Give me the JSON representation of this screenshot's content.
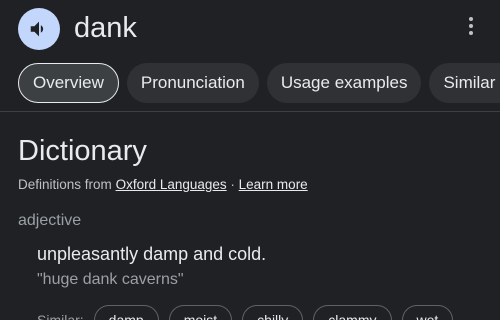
{
  "header": {
    "word": "dank",
    "speaker_icon": "volume-icon",
    "more_icon": "more-vert-icon"
  },
  "tabs": [
    {
      "label": "Overview",
      "active": true
    },
    {
      "label": "Pronunciation",
      "active": false
    },
    {
      "label": "Usage examples",
      "active": false
    },
    {
      "label": "Similar a",
      "active": false
    }
  ],
  "dictionary": {
    "title": "Dictionary",
    "source_prefix": "Definitions from",
    "source_link": "Oxford Languages",
    "separator": " · ",
    "learn_more": "Learn more",
    "part_of_speech": "adjective",
    "definition": "unpleasantly damp and cold.",
    "example": "\"huge dank caverns\""
  },
  "similar": {
    "label": "Similar:",
    "chips": [
      "damp",
      "moist",
      "chilly",
      "clammy",
      "wet"
    ]
  },
  "colors": {
    "background": "#202124",
    "accent_speaker": "#c2d7fb",
    "text_primary": "#e8eaed",
    "text_secondary": "#9aa0a6"
  }
}
